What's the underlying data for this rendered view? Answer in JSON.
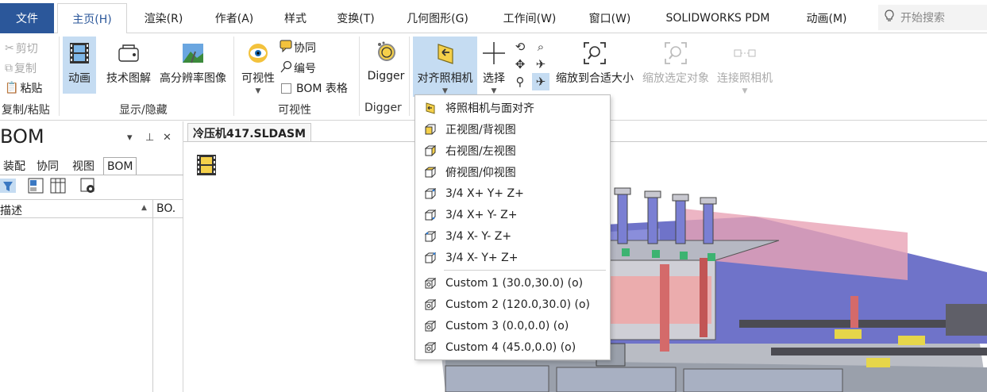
{
  "tabs": {
    "file": "文件",
    "items": [
      "主页(H)",
      "渲染(R)",
      "作者(A)",
      "样式",
      "变换(T)",
      "几何图形(G)",
      "工作间(W)",
      "窗口(W)",
      "SOLIDWORKS PDM",
      "动画(M)"
    ],
    "search_placeholder": "开始搜索"
  },
  "ribbon": {
    "clipboard": {
      "cut": "剪切",
      "copy": "复制",
      "paste": "粘贴",
      "group": "复制/粘贴"
    },
    "show_hide": {
      "animation": "动画",
      "tech_illus": "技术图解",
      "hires": "高分辨率图像",
      "group": "显示/隐藏"
    },
    "visibility": {
      "visibility": "可视性",
      "collab": "协同",
      "numbering": "编号",
      "bom_table": "BOM 表格",
      "group": "可视性"
    },
    "digger": {
      "label": "Digger",
      "group": "Digger"
    },
    "camera": {
      "align": "对齐照相机",
      "select": "选择",
      "zoom_fit": "缩放到合适大小",
      "zoom_sel": "缩放选定对象",
      "connect": "连接照相机"
    }
  },
  "left_panel": {
    "title": "BOM",
    "tabs": [
      "装配",
      "协同",
      "视图",
      "BOM"
    ],
    "columns": {
      "desc": "描述",
      "bom": "BO."
    }
  },
  "document": {
    "tab_title": "冷压机417.SLDASM"
  },
  "menu": {
    "items": [
      "将照相机与面对齐",
      "正视图/背视图",
      "右视图/左视图",
      "俯视图/仰视图",
      "3/4 X+ Y+ Z+",
      "3/4 X+ Y- Z+",
      "3/4 X- Y- Z+",
      "3/4 X- Y+ Z+"
    ],
    "custom": [
      "Custom 1 (30.0,30.0) (o)",
      "Custom 2 (120.0,30.0) (o)",
      "Custom 3 (0.0,0.0) (o)",
      "Custom 4 (45.0,0.0) (o)"
    ]
  },
  "colors": {
    "file_tab": "#2b579a",
    "active_highlight": "#c5dcf2",
    "model_blue": "#6f73c9",
    "model_red": "#d46a6a",
    "model_yellow": "#e6d64a"
  }
}
